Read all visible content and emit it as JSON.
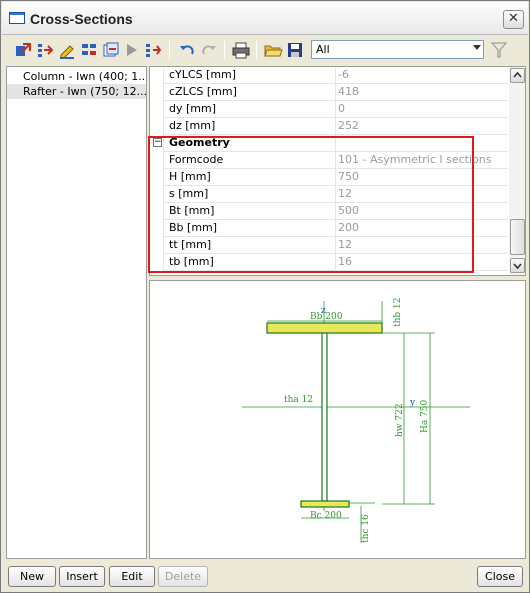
{
  "window": {
    "title": "Cross-Sections",
    "close_glyph": "✕"
  },
  "toolbar": {
    "icons": [
      "new-section-icon",
      "import-icon",
      "edit-icon",
      "copy-icon",
      "export-icon",
      "delete-icon",
      "material-icon",
      "undo-icon",
      "redo-icon",
      "print-icon",
      "open-folder-icon",
      "save-icon",
      "filter-icon"
    ],
    "filter_value": "All"
  },
  "sections": [
    {
      "label": "Column - Iwn (400; 1..."
    },
    {
      "label": "Rafter - Iwn (750; 12..."
    }
  ],
  "properties": {
    "rows": [
      {
        "name": "cYLCS [mm]",
        "value": "-6"
      },
      {
        "name": "cZLCS [mm]",
        "value": "418"
      },
      {
        "name": "dy [mm]",
        "value": "0"
      },
      {
        "name": "dz [mm]",
        "value": "252"
      }
    ],
    "group": {
      "name": "Geometry",
      "collapse_glyph": "−"
    },
    "geometry_rows": [
      {
        "name": "Formcode",
        "value": "101 - Asymmetric I sections"
      },
      {
        "name": "H [mm]",
        "value": "750"
      },
      {
        "name": "s [mm]",
        "value": "12"
      },
      {
        "name": "Bt [mm]",
        "value": "500"
      },
      {
        "name": "Bb [mm]",
        "value": "200"
      },
      {
        "name": "tt [mm]",
        "value": "12"
      },
      {
        "name": "tb [mm]",
        "value": "16"
      }
    ]
  },
  "drawing": {
    "labels": {
      "bb": "Bb 200",
      "z": "z",
      "y": "y",
      "thb": "thb 12",
      "tha": "tha 12",
      "hw": "hw 722",
      "ha": "Ha 750",
      "bc": "Bc 200",
      "thc": "thc 16"
    },
    "colors": {
      "section_line": "#1a7a1a",
      "flange_fill": "#e8e85a",
      "dim_line": "#2a9a2a"
    }
  },
  "buttons": {
    "new": "New",
    "insert": "Insert",
    "edit": "Edit",
    "delete": "Delete",
    "close": "Close"
  }
}
